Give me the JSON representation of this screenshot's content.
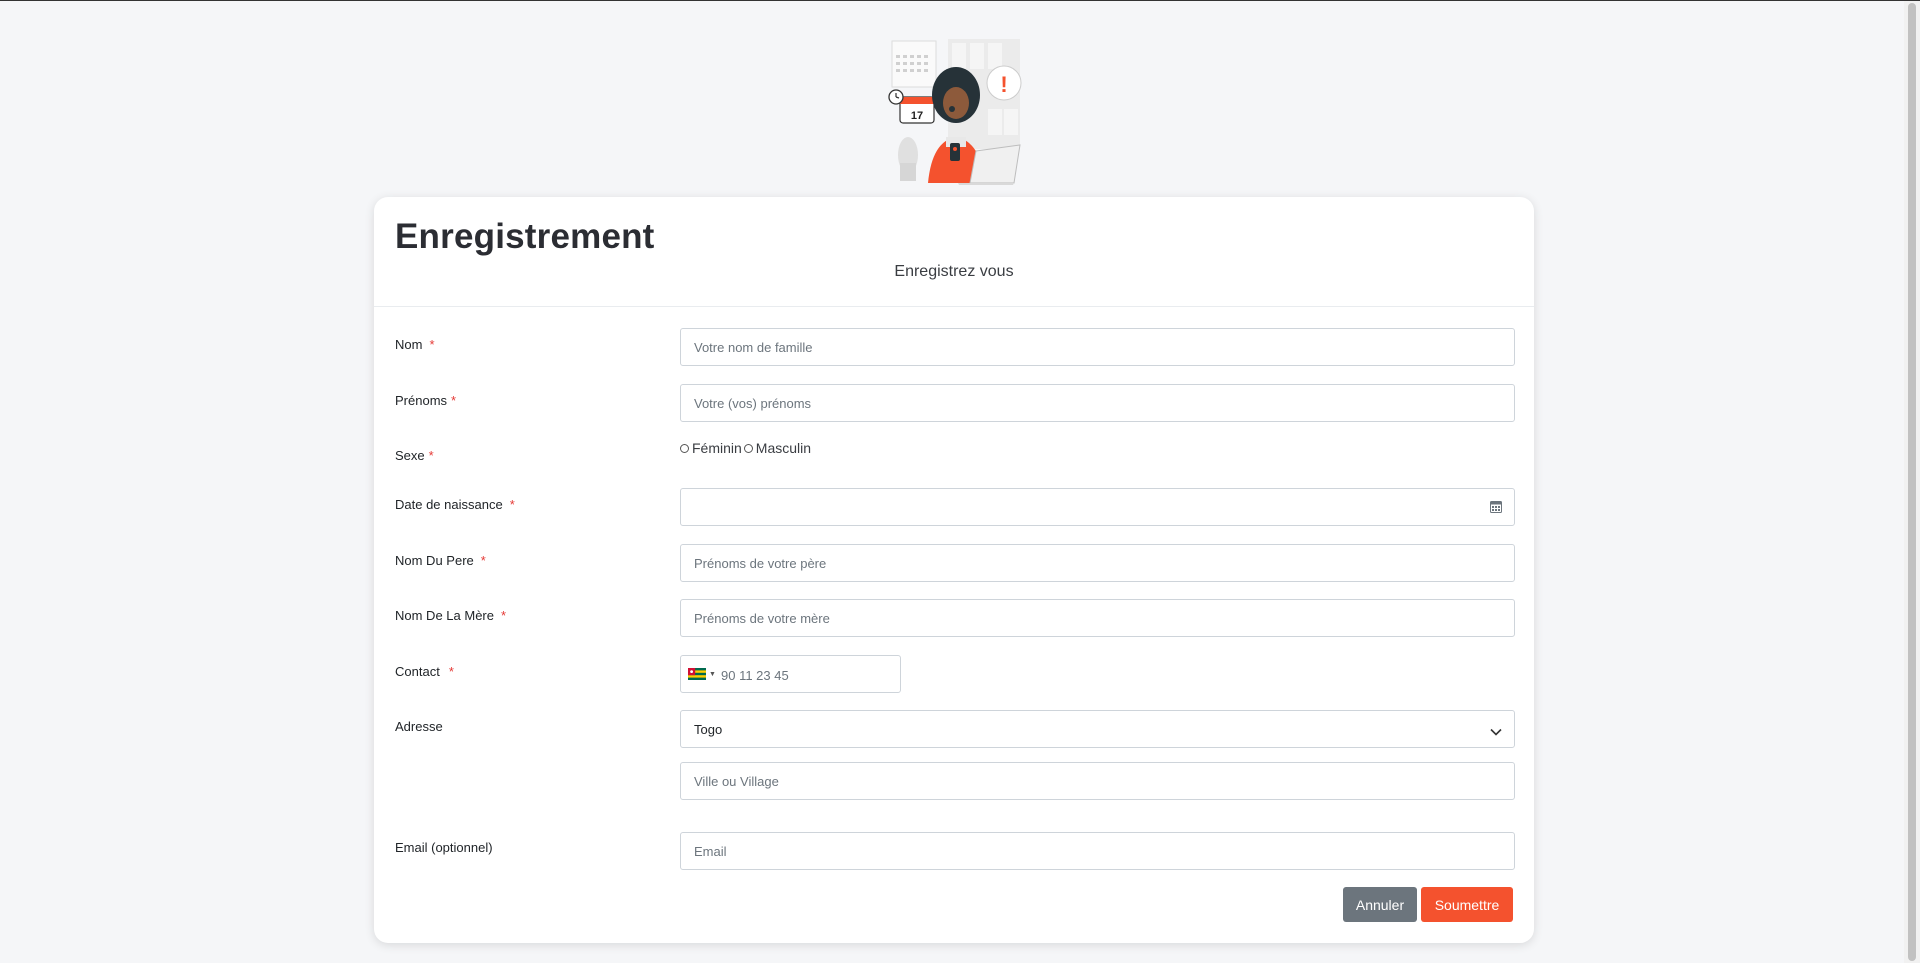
{
  "illustration": {
    "calendar_day": "17",
    "alert_symbol": "!"
  },
  "header": {
    "title": "Enregistrement",
    "subtitle": "Enregistrez vous"
  },
  "form": {
    "nom": {
      "label": "Nom",
      "required": "*",
      "placeholder": "Votre nom de famille"
    },
    "prenoms": {
      "label": "Prénoms",
      "required": "*",
      "placeholder": "Votre (vos) prénoms"
    },
    "sexe": {
      "label": "Sexe",
      "required": "*",
      "options": [
        "Féminin",
        "Masculin"
      ]
    },
    "date_naissance": {
      "label": "Date de naissance",
      "required": "*",
      "icon": "calendar-icon"
    },
    "nom_pere": {
      "label": "Nom Du Pere",
      "required": "*",
      "placeholder": "Prénoms de votre père"
    },
    "nom_mere": {
      "label": "Nom De La Mère",
      "required": "*",
      "placeholder": "Prénoms de votre mère"
    },
    "contact": {
      "label": "Contact",
      "required": "*",
      "placeholder": "90 11 23 45",
      "country_flag": "togo-flag-icon"
    },
    "adresse": {
      "label": "Adresse",
      "country": "Togo",
      "city_placeholder": "Ville ou Village"
    },
    "email": {
      "label": "Email (optionnel)",
      "placeholder": "Email"
    }
  },
  "actions": {
    "cancel_label": "Annuler",
    "submit_label": "Soumettre"
  },
  "colors": {
    "accent": "#f4522e",
    "cancel": "#6c757d",
    "required": "#e53935",
    "background": "#f5f6f8"
  }
}
